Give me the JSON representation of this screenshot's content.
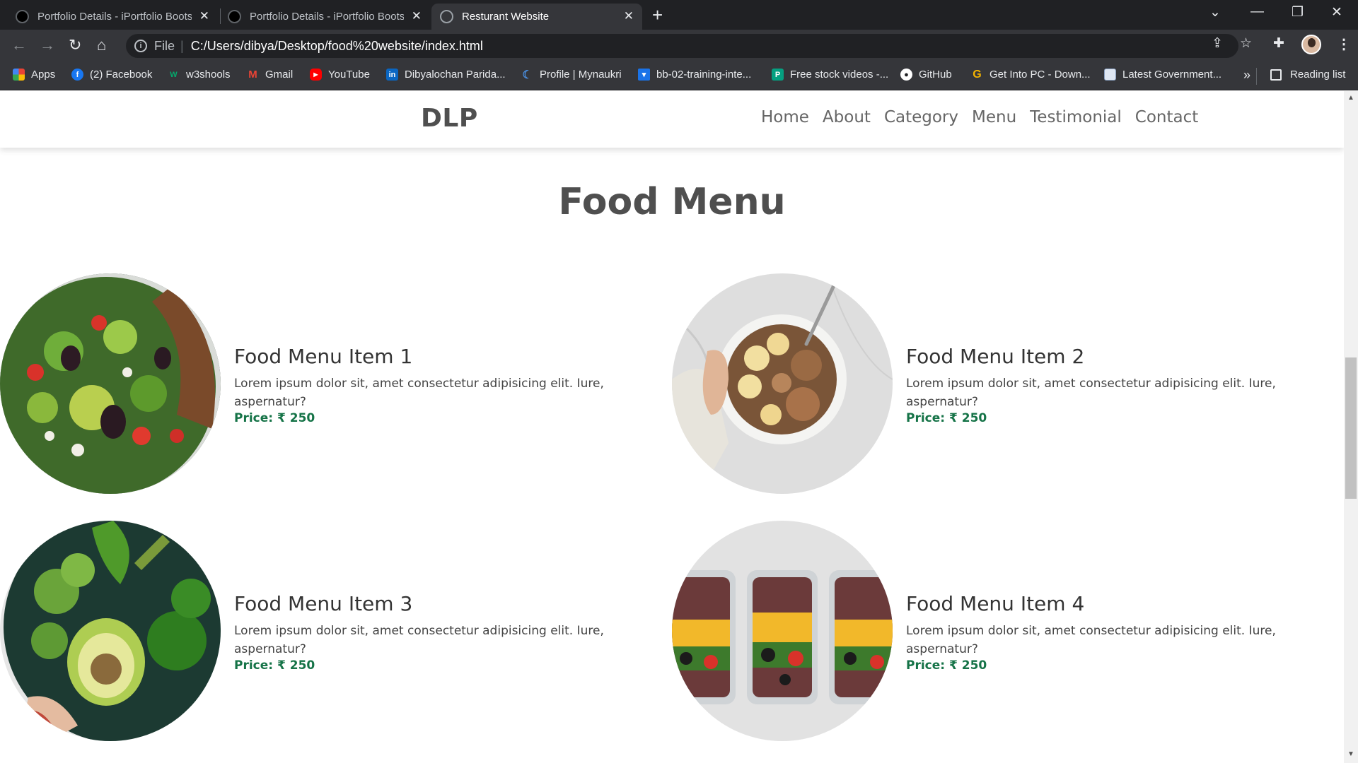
{
  "browser": {
    "tabs": [
      {
        "title": "Portfolio Details - iPortfolio Bootstrap",
        "active": false
      },
      {
        "title": "Portfolio Details - iPortfolio Bootstrap",
        "active": false
      },
      {
        "title": "Resturant Website",
        "active": true
      }
    ],
    "close_glyph": "✕",
    "new_tab_glyph": "+",
    "address": {
      "scheme": "File",
      "url": "C:/Users/dibya/Desktop/food%20website/index.html"
    },
    "bookmarks": [
      {
        "label": "Apps",
        "icon": "apps-grid-icon"
      },
      {
        "label": "(2) Facebook",
        "icon": "facebook-icon"
      },
      {
        "label": "w3shools",
        "icon": "w3schools-icon"
      },
      {
        "label": "Gmail",
        "icon": "gmail-icon"
      },
      {
        "label": "YouTube",
        "icon": "youtube-icon"
      },
      {
        "label": "Dibyalochan Parida...",
        "icon": "linkedin-icon"
      },
      {
        "label": "Profile | Mynaukri",
        "icon": "naukri-icon"
      },
      {
        "label": "bb-02-training-inte...",
        "icon": "bookmark-icon"
      },
      {
        "label": "Free stock videos -...",
        "icon": "pexels-icon"
      },
      {
        "label": "GitHub",
        "icon": "github-icon"
      },
      {
        "label": "Get Into PC - Down...",
        "icon": "getintopc-icon"
      },
      {
        "label": "Latest Government...",
        "icon": "news-icon"
      }
    ],
    "more_bookmarks": "»",
    "reading_list": "Reading list"
  },
  "site": {
    "logo": "DLP",
    "nav": [
      "Home",
      "About",
      "Category",
      "Menu",
      "Testimonial",
      "Contact"
    ],
    "section_title": "Food Menu",
    "items": [
      {
        "title": "Food Menu Item 1",
        "description": "Lorem ipsum dolor sit, amet consectetur adipisicing elit. Iure, aspernatur?",
        "price": "Price: ₹ 250",
        "image": "salad"
      },
      {
        "title": "Food Menu Item 2",
        "description": "Lorem ipsum dolor sit, amet consectetur adipisicing elit. Iure, aspernatur?",
        "price": "Price: ₹ 250",
        "image": "granola-bowl"
      },
      {
        "title": "Food Menu Item 3",
        "description": "Lorem ipsum dolor sit, amet consectetur adipisicing elit. Iure, aspernatur?",
        "price": "Price: ₹ 250",
        "image": "green-vegetables"
      },
      {
        "title": "Food Menu Item 4",
        "description": "Lorem ipsum dolor sit, amet consectetur adipisicing elit. Iure, aspernatur?",
        "price": "Price: ₹ 250",
        "image": "meal-prep-containers"
      }
    ],
    "colors": {
      "price": "#157347",
      "text": "#444444",
      "logo": "#4f4f4f"
    }
  }
}
